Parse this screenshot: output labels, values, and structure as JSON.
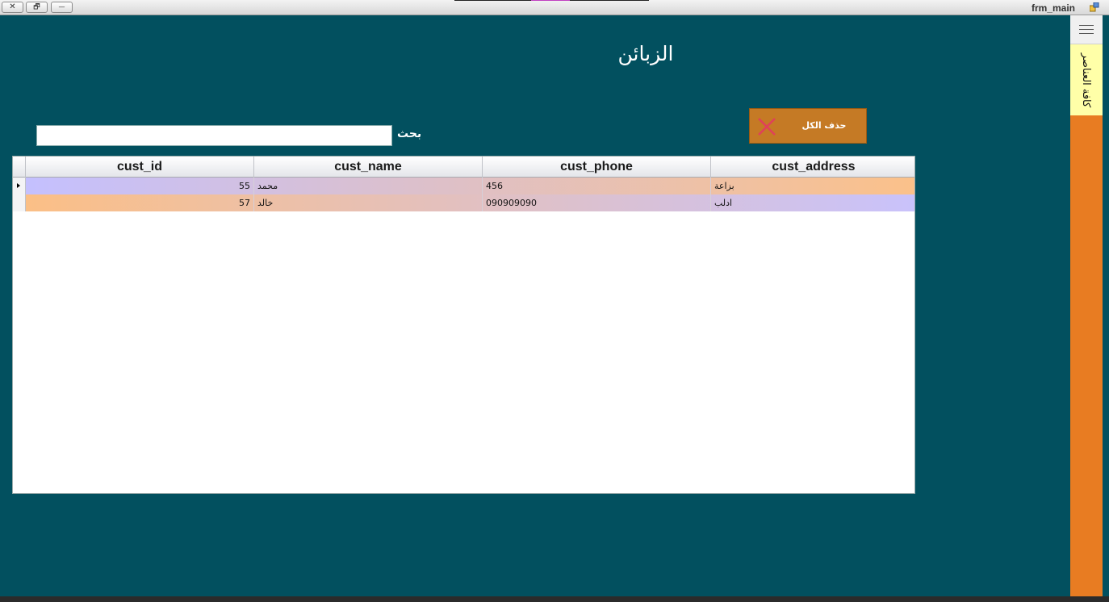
{
  "window": {
    "title": "frm_main",
    "close_glyph": "✕",
    "restore_glyph": "🗗",
    "minimize_glyph": "—"
  },
  "form": {
    "title": "الزبائن",
    "delete_all_label": "حذف الكل",
    "search_label": "بحث",
    "search_value": ""
  },
  "grid": {
    "columns": [
      "cust_id",
      "cust_name",
      "cust_phone",
      "cust_address"
    ],
    "rows": [
      {
        "cust_id": "55",
        "cust_name": "محمد",
        "cust_phone": "456",
        "cust_address": "بزاعة"
      },
      {
        "cust_id": "57",
        "cust_name": "خالد",
        "cust_phone": "090909090",
        "cust_address": "ادلب"
      }
    ]
  },
  "side_panel": {
    "tab_label": "كافة العناصر"
  },
  "colors": {
    "background": "#02505F",
    "button": "#C57A25",
    "side_panel": "#E87C22",
    "side_tab": "#FFFFA8"
  }
}
